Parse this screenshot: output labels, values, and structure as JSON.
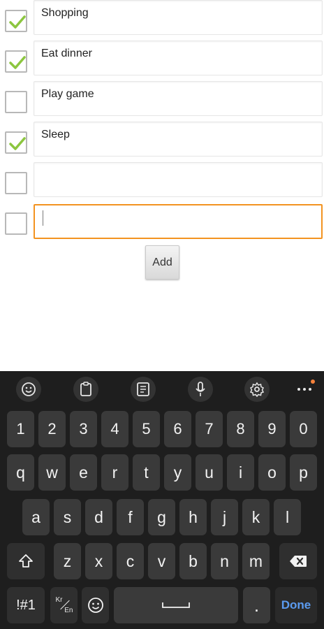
{
  "tasks": [
    {
      "text": "Shopping",
      "checked": true
    },
    {
      "text": "Eat dinner",
      "checked": true
    },
    {
      "text": "Play game",
      "checked": false
    },
    {
      "text": "Sleep",
      "checked": true
    },
    {
      "text": "",
      "checked": false
    },
    {
      "text": "",
      "checked": false,
      "focused": true
    }
  ],
  "add_button_label": "Add",
  "colors": {
    "checkmark": "#8cc63f",
    "focus_border": "#f39320",
    "keyboard_bg": "#1e1e1e",
    "key_bg": "#3a3a3a",
    "done_text": "#5b9bf0",
    "notify_dot": "#f5813b"
  },
  "keyboard": {
    "toolbar_icons": [
      "emoji-icon",
      "clipboard-icon",
      "text-editing-icon",
      "microphone-icon",
      "settings-icon",
      "more-icon"
    ],
    "number_row": [
      "1",
      "2",
      "3",
      "4",
      "5",
      "6",
      "7",
      "8",
      "9",
      "0"
    ],
    "row1": [
      "q",
      "w",
      "e",
      "r",
      "t",
      "y",
      "u",
      "i",
      "o",
      "p"
    ],
    "row2": [
      "a",
      "s",
      "d",
      "f",
      "g",
      "h",
      "j",
      "k",
      "l"
    ],
    "row3": [
      "z",
      "x",
      "c",
      "v",
      "b",
      "n",
      "m"
    ],
    "symbols_label": "!#1",
    "lang_label_top": "Kr",
    "lang_label_bottom": "En",
    "period_label": ".",
    "done_label": "Done"
  }
}
